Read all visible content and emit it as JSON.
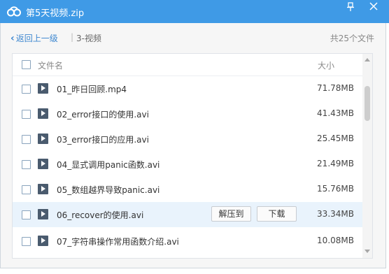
{
  "window": {
    "title": "第5天视频.zip",
    "pin_icon": "pin-icon",
    "close_icon": "close-icon"
  },
  "nav": {
    "back_label": "返回上一级",
    "separator": "|",
    "current_folder": "3-视频",
    "file_count": "共25个文件"
  },
  "list": {
    "header_name": "文件名",
    "header_size": "大小",
    "files": [
      {
        "name": "01_昨日回顾.mp4",
        "size": "71.78MB"
      },
      {
        "name": "02_error接口的使用.avi",
        "size": "41.43MB"
      },
      {
        "name": "03_error接口的应用.avi",
        "size": "25.45MB"
      },
      {
        "name": "04_显式调用panic函数.avi",
        "size": "21.49MB"
      },
      {
        "name": "05_数组越界导致panic.avi",
        "size": "15.76MB"
      },
      {
        "name": "06_recover的使用.avi",
        "size": "33.34MB"
      },
      {
        "name": "07_字符串操作常用函数介绍.avi",
        "size": "10.08MB"
      }
    ],
    "extract_label": "解压到",
    "download_label": "下载"
  },
  "colors": {
    "titlebar": "#3f9ae6",
    "link": "#3f88d0",
    "row_hover": "#e9f3fc"
  }
}
